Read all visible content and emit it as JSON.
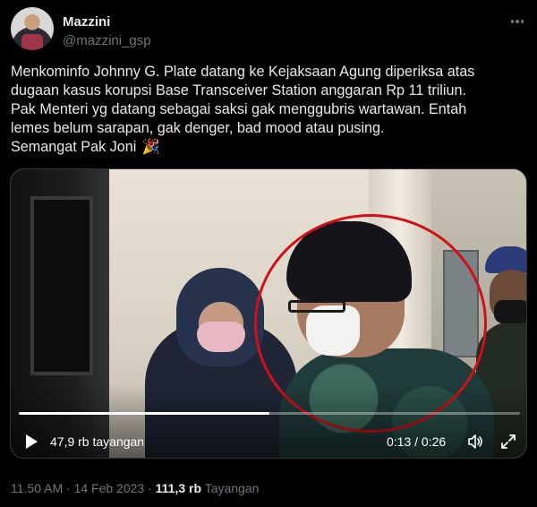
{
  "author": {
    "display_name": "Mazzini",
    "handle": "@mazzini_gsp",
    "avatar": "profile-photo"
  },
  "tweet": {
    "lines": [
      "Menkominfo Johnny G. Plate datang ke Kejaksaan Agung diperiksa atas",
      "dugaan kasus korupsi Base Transceiver Station anggaran Rp 11 triliun.",
      "Pak Menteri yg datang sebagai saksi gak menggubris wartawan. Entah",
      "lemes belum sarapan, gak denger, bad mood atau pusing.",
      "Semangat Pak Joni"
    ],
    "emoji": "🎉"
  },
  "video": {
    "views_label": "47,9 rb tayangan",
    "current_time": "0:13",
    "duration": "0:26",
    "time_display": "0:13 / 0:26",
    "progress": 0.5,
    "icons": {
      "play": "play-icon",
      "volume": "volume-icon",
      "fullscreen": "fullscreen-icon"
    }
  },
  "meta": {
    "time": "11.50 AM",
    "separator": "·",
    "date": "14 Feb 2023",
    "views_count": "111,3 rb",
    "views_label": "Tayangan"
  },
  "colors": {
    "background": "#000000",
    "text": "#e7e9ea",
    "muted": "#71767b",
    "annotation_circle": "#d10f1a"
  }
}
